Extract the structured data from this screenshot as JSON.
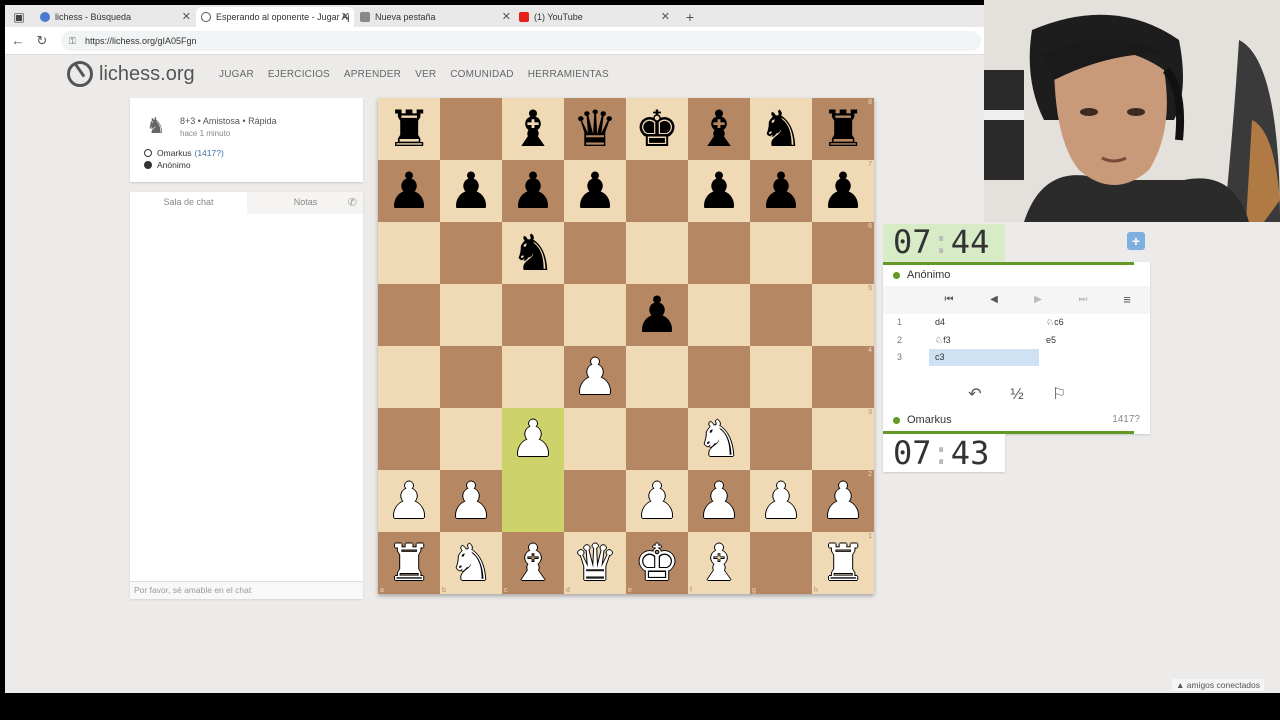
{
  "browser": {
    "tabs": [
      {
        "title": "lichess - Búsqueda",
        "favicon_color": "#4a7bd0"
      },
      {
        "title": "Esperando al oponente - Jugar Aj",
        "favicon_color": "#555555"
      },
      {
        "title": "Nueva pestaña",
        "favicon_color": "#888888"
      },
      {
        "title": "(1) YouTube",
        "favicon_color": "#e62117"
      }
    ],
    "url": "https://lichess.org/gIA05Fgn"
  },
  "site": {
    "logo_text": "lichess.org",
    "nav": [
      "JUGAR",
      "EJERCICIOS",
      "APRENDER",
      "VER",
      "COMUNIDAD",
      "HERRAMIENTAS"
    ]
  },
  "game": {
    "meta": "8+3 • Amistosa • Rápida",
    "time_ago": "hace 1 minuto",
    "white_player": "Omarkus",
    "white_rating": "(1417?)",
    "black_player": "Anónimo"
  },
  "chat": {
    "tab_chat": "Sala de chat",
    "tab_notes": "Notas",
    "placeholder": "Por favor, sé amable en el chat"
  },
  "board": {
    "ranks": [
      [
        "bR",
        "",
        "bB",
        "bQ",
        "bK",
        "bB",
        "bN",
        "bR"
      ],
      [
        "bP",
        "bP",
        "bP",
        "bP",
        "",
        "bP",
        "bP",
        "bP"
      ],
      [
        "",
        "",
        "bN",
        "",
        "",
        "",
        "",
        ""
      ],
      [
        "",
        "",
        "",
        "",
        "bP",
        "",
        "",
        ""
      ],
      [
        "",
        "",
        "",
        "wP",
        "",
        "",
        "",
        ""
      ],
      [
        "",
        "",
        "wP",
        "",
        "",
        "wN",
        "",
        ""
      ],
      [
        "wP",
        "wP",
        "",
        "",
        "wP",
        "wP",
        "wP",
        "wP"
      ],
      [
        "wR",
        "wN",
        "wB",
        "wQ",
        "wK",
        "wB",
        "",
        "wR"
      ]
    ],
    "highlight": [
      "c3",
      "c2"
    ],
    "rank_labels": [
      "8",
      "7",
      "6",
      "5",
      "4",
      "3",
      "2",
      "1"
    ],
    "file_labels": [
      "a",
      "b",
      "c",
      "d",
      "e",
      "f",
      "g",
      "h"
    ]
  },
  "clocks": {
    "top_min": "07",
    "top_sec": "44",
    "bottom_min": "07",
    "bottom_sec": "43"
  },
  "panel": {
    "top_player": "Anónimo",
    "bottom_player": "Omarkus",
    "bottom_rating": "1417?",
    "moves": [
      {
        "n": "1",
        "w": "d4",
        "b": "♘c6"
      },
      {
        "n": "2",
        "w": "♘f3",
        "b": "e5"
      },
      {
        "n": "3",
        "w": "c3",
        "b": ""
      }
    ],
    "draw_symbol": "½"
  },
  "footer": {
    "friends": "▲ amigos conectados"
  }
}
